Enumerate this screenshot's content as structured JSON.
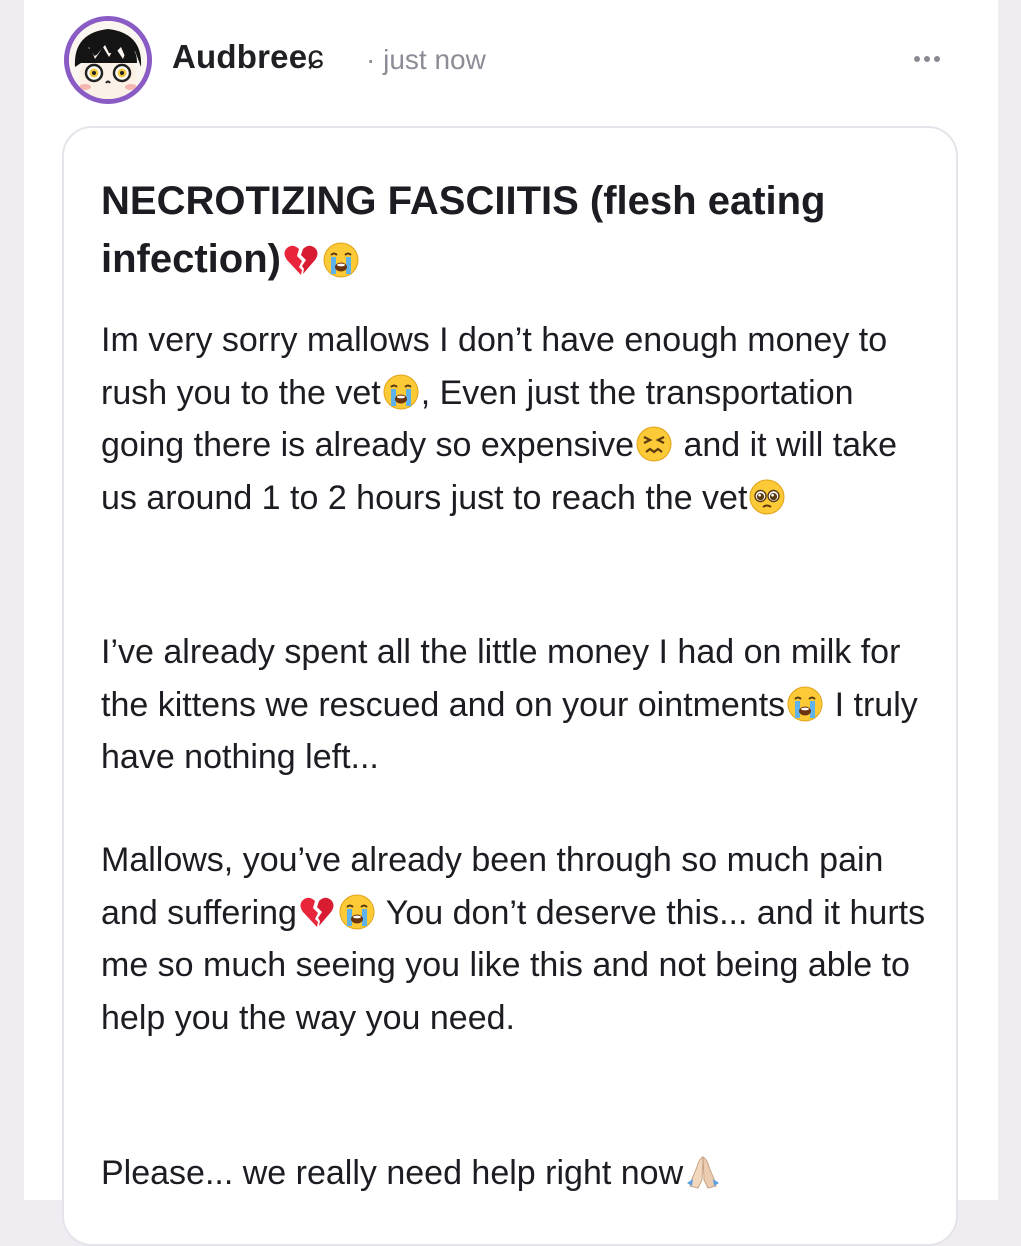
{
  "post": {
    "author": "Audbree",
    "author_suffix_glyph": "ɕ",
    "time": "· just now",
    "menu_label": "more options",
    "title": {
      "text": "NECROTIZING FASCIITIS (flesh eating infection)",
      "emojis": [
        "broken-heart",
        "loudly-crying-face"
      ]
    },
    "paragraphs": [
      {
        "segments": [
          {
            "text": "Im very sorry mallows I don’t have enough money to rush you to the vet"
          },
          {
            "emoji": "loudly-crying-face"
          },
          {
            "text": ", Even just the transportation going there is already so expensive"
          },
          {
            "emoji": "confounded-face"
          },
          {
            "text": " and it will take us around 1 to 2 hours just to reach the vet"
          },
          {
            "emoji": "pleading-face"
          }
        ]
      },
      {
        "segments": [
          {
            "text": "I’ve already spent all the little money I had on milk for the kittens we rescued and on your ointments"
          },
          {
            "emoji": "loudly-crying-face"
          },
          {
            "text": " I truly have nothing left..."
          }
        ]
      },
      {
        "segments": [
          {
            "text": "Mallows, you’ve already been through so much pain and suffering"
          },
          {
            "emoji": "broken-heart"
          },
          {
            "emoji": "loudly-crying-face"
          },
          {
            "text": " You don’t deserve this... and it hurts me so much seeing you like this and not being able to help you the way you need."
          }
        ]
      },
      {
        "segments": [
          {
            "text": "Please... we really need help right now"
          },
          {
            "emoji": "folded-hands"
          }
        ]
      }
    ]
  },
  "colors": {
    "avatar_ring": "#8a5bc4",
    "text": "#1c1c22",
    "muted": "#8f8b96",
    "card_border": "#e6e3ea"
  }
}
